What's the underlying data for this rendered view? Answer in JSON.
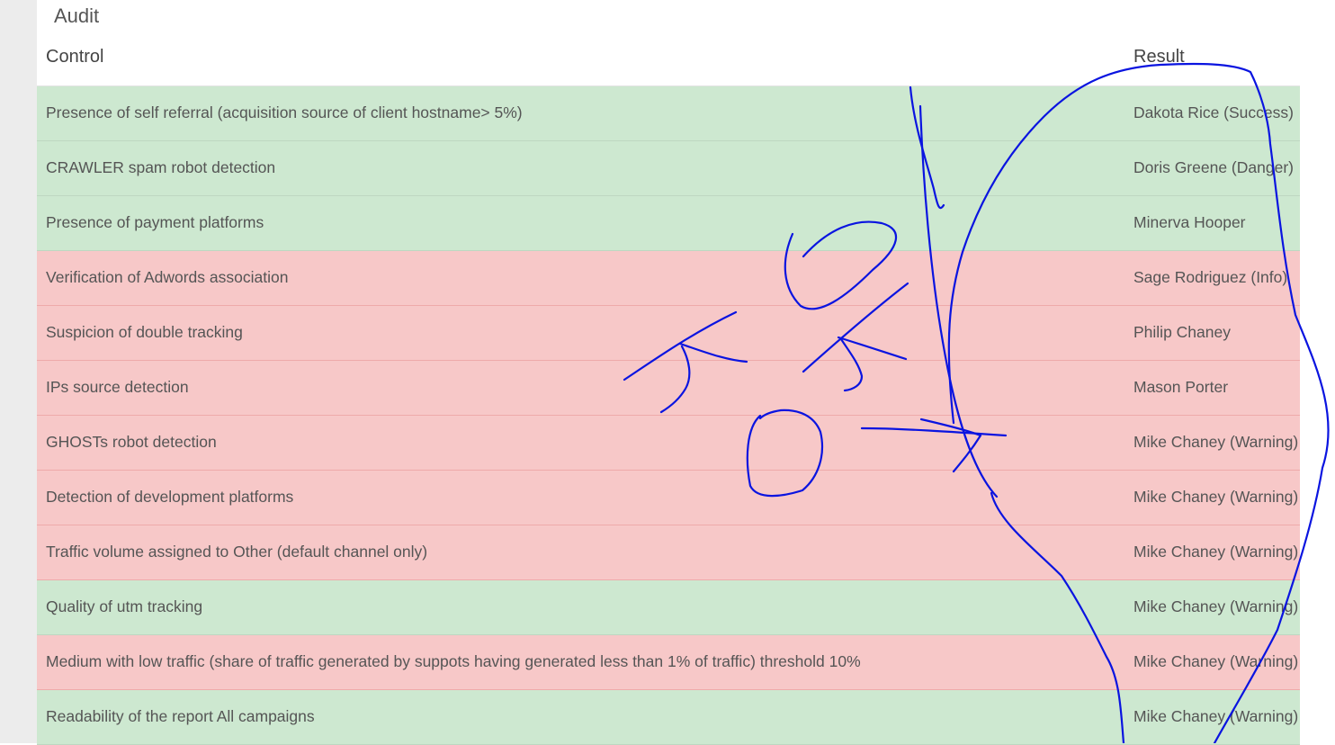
{
  "title": "Audit",
  "columns": {
    "control": "Control",
    "result": "Result"
  },
  "rows": [
    {
      "control": "Presence of self referral (acquisition source of client hostname> 5%)",
      "result": "Dakota Rice (Success)",
      "status": "success"
    },
    {
      "control": "CRAWLER spam robot detection",
      "result": "Doris Greene (Danger)",
      "status": "success"
    },
    {
      "control": "Presence of payment platforms",
      "result": "Minerva Hooper",
      "status": "success"
    },
    {
      "control": "Verification of Adwords association",
      "result": "Sage Rodriguez (Info)",
      "status": "danger"
    },
    {
      "control": "Suspicion of double tracking",
      "result": "Philip Chaney",
      "status": "danger"
    },
    {
      "control": "IPs source detection",
      "result": "Mason Porter",
      "status": "danger"
    },
    {
      "control": "GHOSTs robot detection",
      "result": "Mike Chaney (Warning)",
      "status": "danger"
    },
    {
      "control": "Detection of development platforms",
      "result": "Mike Chaney (Warning)",
      "status": "danger"
    },
    {
      "control": "Traffic volume assigned to Other (default channel only)",
      "result": "Mike Chaney (Warning)",
      "status": "danger"
    },
    {
      "control": "Quality of utm tracking",
      "result": "Mike Chaney (Warning)",
      "status": "success"
    },
    {
      "control": "Medium with low traffic (share of traffic generated by suppots having generated less than 1% of traffic) threshold 10%",
      "result": "Mike Chaney (Warning)",
      "status": "danger"
    },
    {
      "control": "Readability of the report All campaigns",
      "result": "Mike Chaney (Warning)",
      "status": "success"
    }
  ],
  "colors": {
    "success_row": "#cde8d0",
    "danger_row": "#f7c8c8",
    "annotation_ink": "#0a14e0"
  }
}
